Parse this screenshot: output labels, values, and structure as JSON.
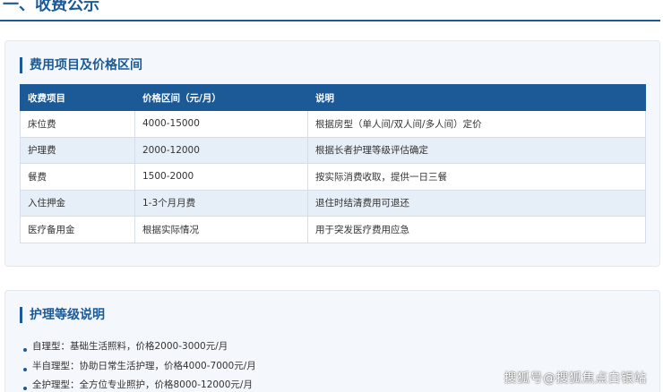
{
  "section": {
    "title": "一、收费公示"
  },
  "fee_card": {
    "title": "费用项目及价格区间",
    "headers": [
      "收费项目",
      "价格区间（元/月）",
      "说明"
    ],
    "rows": [
      [
        "床位费",
        "4000-15000",
        "根据房型（单人间/双人间/多人间）定价"
      ],
      [
        "护理费",
        "2000-12000",
        "根据长者护理等级评估确定"
      ],
      [
        "餐费",
        "1500-2000",
        "按实际消费收取，提供一日三餐"
      ],
      [
        "入住押金",
        "1-3个月月费",
        "退住时结清费用可退还"
      ],
      [
        "医疗备用金",
        "根据实际情况",
        "用于突发医疗费用应急"
      ]
    ]
  },
  "care_card": {
    "title": "护理等级说明",
    "items": [
      "自理型：基础生活照料，价格2000-3000元/月",
      "半自理型：协助日常生活护理，价格4000-7000元/月",
      "全护理型：全方位专业照护，价格8000-12000元/月"
    ]
  },
  "watermark": "搜狐号@搜狐焦点白银站",
  "colors": {
    "accent": "#1b5a96",
    "card_bg": "#f4f7fb",
    "row_alt": "#e6eef7"
  }
}
